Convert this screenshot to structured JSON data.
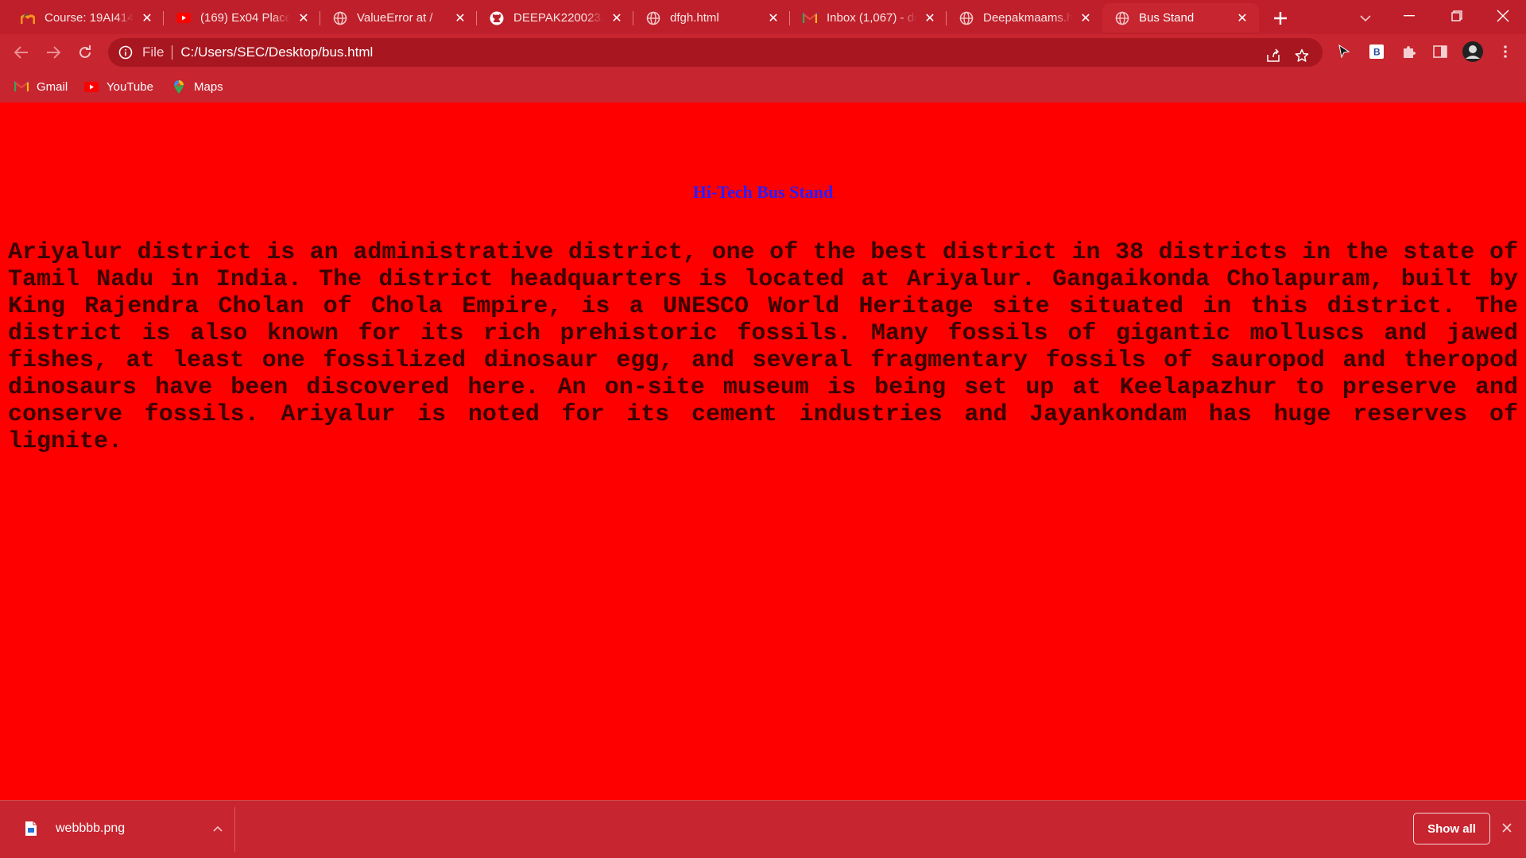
{
  "tabs": [
    {
      "title": "Course: 19AI414-",
      "icon": "moodle-icon",
      "active": false
    },
    {
      "title": "(169) Ex04 Places",
      "icon": "youtube-icon",
      "active": false
    },
    {
      "title": "ValueError at /",
      "icon": "globe-icon",
      "active": false
    },
    {
      "title": "DEEPAK2200233/",
      "icon": "github-icon",
      "active": false
    },
    {
      "title": "dfgh.html",
      "icon": "globe-icon",
      "active": false
    },
    {
      "title": "Inbox (1,067) - de",
      "icon": "gmail-icon",
      "active": false
    },
    {
      "title": "Deepakmaams.ht",
      "icon": "globe-icon",
      "active": false
    },
    {
      "title": "Bus Stand",
      "icon": "globe-icon",
      "active": true
    }
  ],
  "address_bar": {
    "scheme_label": "File",
    "url": "C:/Users/SEC/Desktop/bus.html"
  },
  "bookmarks": [
    {
      "label": "Gmail",
      "icon": "gmail-icon"
    },
    {
      "label": "YouTube",
      "icon": "youtube-icon"
    },
    {
      "label": "Maps",
      "icon": "maps-icon"
    }
  ],
  "page": {
    "heading": "Hi-Tech Bus Stand",
    "paragraph": "Ariyalur district is an administrative district, one of the best district in 38 districts in the state of Tamil Nadu in India. The district headquarters is located at Ariyalur. Gangaikonda Cholapuram, built by King Rajendra Cholan of Chola Empire, is a UNESCO World Heritage site situated in this district. The district is also known for its rich prehistoric fossils. Many fossils of gigantic molluscs and jawed fishes, at least one fossilized dinosaur egg, and several fragmentary fossils of sauropod and theropod dinosaurs have been discovered here. An on-site museum is being set up at Keelapazhur to preserve and conserve fossils. Ariyalur is noted for its cement industries and Jayankondam has huge reserves of lignite.",
    "background_color": "#ff0000",
    "heading_color": "#2b1cff"
  },
  "download_bar": {
    "file_name": "webbbb.png",
    "show_all_label": "Show all"
  },
  "theme": {
    "chrome_color": "#c7252f",
    "omnibox_color": "#a81620"
  }
}
